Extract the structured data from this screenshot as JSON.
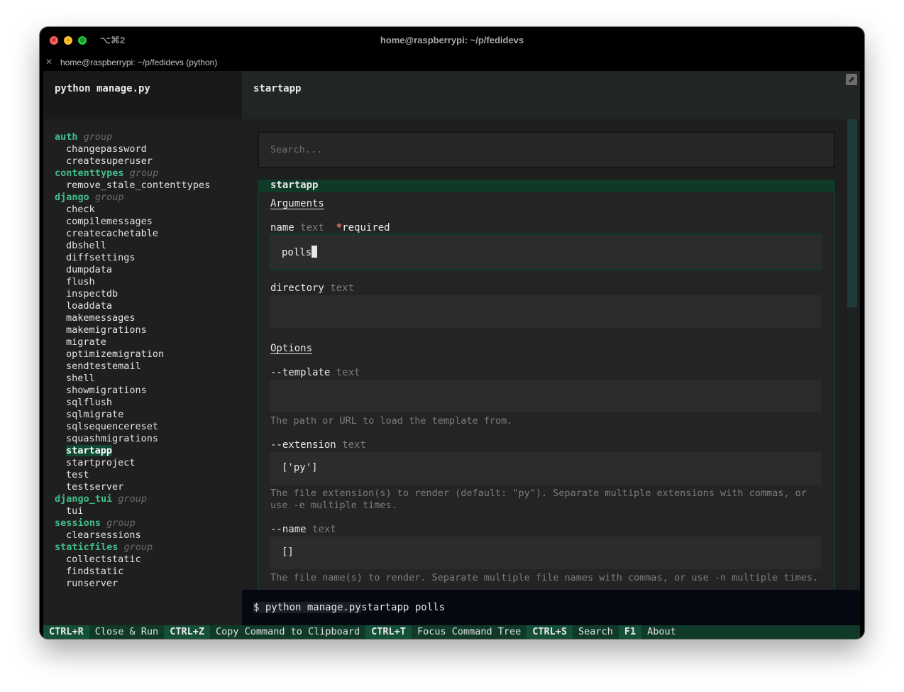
{
  "window": {
    "shortcut": "⌥⌘2",
    "title": "home@raspberrypi: ~/p/fedidevs",
    "tab_label": "home@raspberrypi: ~/p/fedidevs (python)"
  },
  "left_header": {
    "title": "python manage.py"
  },
  "right_header": {
    "title": "startapp"
  },
  "tree": {
    "rows": [
      {
        "kind": "group",
        "label": "auth",
        "tag": "group"
      },
      {
        "kind": "cmd",
        "label": "changepassword"
      },
      {
        "kind": "cmd",
        "label": "createsuperuser"
      },
      {
        "kind": "group",
        "label": "contenttypes",
        "tag": "group"
      },
      {
        "kind": "cmd",
        "label": "remove_stale_contenttypes"
      },
      {
        "kind": "group",
        "label": "django",
        "tag": "group"
      },
      {
        "kind": "cmd",
        "label": "check"
      },
      {
        "kind": "cmd",
        "label": "compilemessages"
      },
      {
        "kind": "cmd",
        "label": "createcachetable"
      },
      {
        "kind": "cmd",
        "label": "dbshell"
      },
      {
        "kind": "cmd",
        "label": "diffsettings"
      },
      {
        "kind": "cmd",
        "label": "dumpdata"
      },
      {
        "kind": "cmd",
        "label": "flush"
      },
      {
        "kind": "cmd",
        "label": "inspectdb"
      },
      {
        "kind": "cmd",
        "label": "loaddata"
      },
      {
        "kind": "cmd",
        "label": "makemessages"
      },
      {
        "kind": "cmd",
        "label": "makemigrations"
      },
      {
        "kind": "cmd",
        "label": "migrate"
      },
      {
        "kind": "cmd",
        "label": "optimizemigration"
      },
      {
        "kind": "cmd",
        "label": "sendtestemail"
      },
      {
        "kind": "cmd",
        "label": "shell"
      },
      {
        "kind": "cmd",
        "label": "showmigrations"
      },
      {
        "kind": "cmd",
        "label": "sqlflush"
      },
      {
        "kind": "cmd",
        "label": "sqlmigrate"
      },
      {
        "kind": "cmd",
        "label": "sqlsequencereset"
      },
      {
        "kind": "cmd",
        "label": "squashmigrations"
      },
      {
        "kind": "cmd",
        "label": "startapp",
        "selected": true
      },
      {
        "kind": "cmd",
        "label": "startproject"
      },
      {
        "kind": "cmd",
        "label": "test"
      },
      {
        "kind": "cmd",
        "label": "testserver"
      },
      {
        "kind": "group",
        "label": "django_tui",
        "tag": "group"
      },
      {
        "kind": "cmd",
        "label": "tui"
      },
      {
        "kind": "group",
        "label": "sessions",
        "tag": "group"
      },
      {
        "kind": "cmd",
        "label": "clearsessions"
      },
      {
        "kind": "group",
        "label": "staticfiles",
        "tag": "group"
      },
      {
        "kind": "cmd",
        "label": "collectstatic"
      },
      {
        "kind": "cmd",
        "label": "findstatic"
      },
      {
        "kind": "cmd",
        "label": "runserver"
      }
    ]
  },
  "search": {
    "placeholder": "Search...",
    "value": ""
  },
  "panel": {
    "title": "startapp",
    "arguments_title": "Arguments",
    "options_title": "Options",
    "args": {
      "name": {
        "label": "name",
        "type": "text",
        "required": "*required",
        "value": "polls"
      },
      "directory": {
        "label": "directory",
        "type": "text",
        "value": ""
      }
    },
    "opts": {
      "template": {
        "label": "--template",
        "type": "text",
        "value": "",
        "help": "The path or URL to load the template from."
      },
      "extension": {
        "label": "--extension",
        "type": "text",
        "value": "['py']",
        "help": "The file extension(s) to render (default: \"py\"). Separate multiple extensions with commas, or use -e multiple times."
      },
      "name": {
        "label": "--name",
        "type": "text",
        "value": "[]",
        "help": "The file name(s) to render. Separate multiple file names with commas, or use -n multiple times."
      }
    }
  },
  "command_line": {
    "prompt": "$ python manage.py",
    "rest": "startapp polls"
  },
  "footer": {
    "bindings": [
      {
        "key": "CTRL+R",
        "label": "Close & Run"
      },
      {
        "key": "CTRL+Z",
        "label": "Copy Command to Clipboard"
      },
      {
        "key": "CTRL+T",
        "label": "Focus Command Tree"
      },
      {
        "key": "CTRL+S",
        "label": "Search"
      },
      {
        "key": "F1",
        "label": "About"
      }
    ]
  },
  "colors": {
    "accent_green": "#3fbf8c",
    "panel_green": "#0f3a28",
    "required_red": "#ff6b6b"
  }
}
